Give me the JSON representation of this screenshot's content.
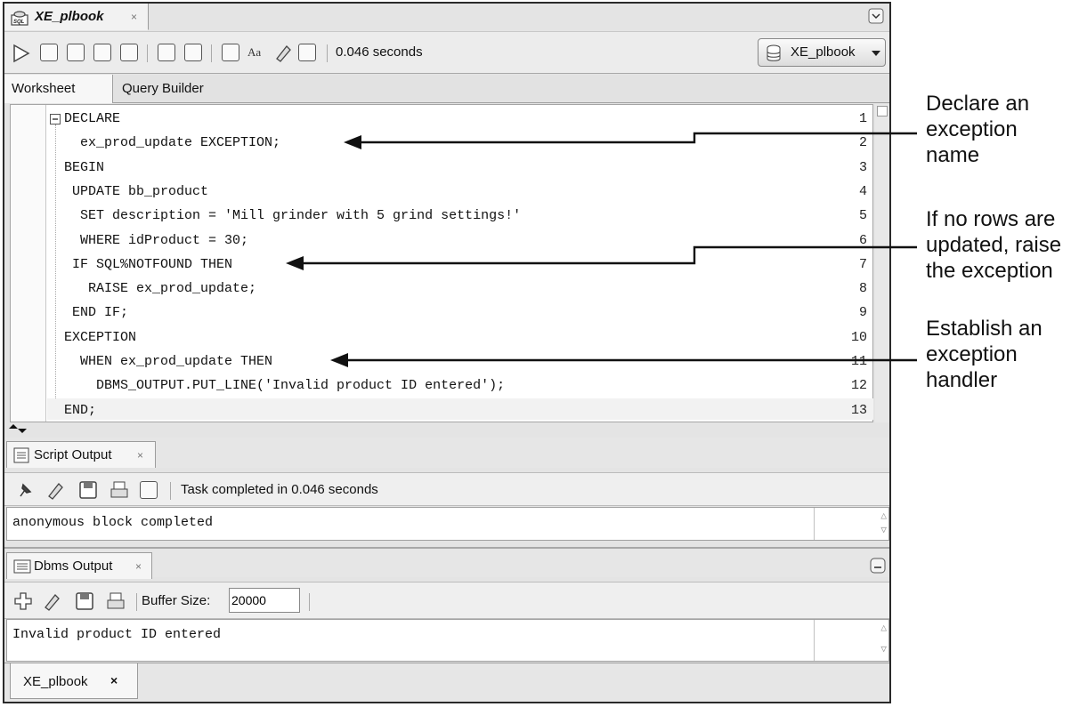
{
  "document_tab": {
    "label": "XE_plbook",
    "close": "×"
  },
  "toolbar": {
    "status_text": "0.046 seconds",
    "connection": "XE_plbook"
  },
  "subtabs": [
    "Worksheet",
    "Query Builder"
  ],
  "editor": {
    "lines": [
      {
        "num": "1",
        "text": "DECLARE"
      },
      {
        "num": "2",
        "text": "  ex_prod_update EXCEPTION;"
      },
      {
        "num": "3",
        "text": "BEGIN"
      },
      {
        "num": "4",
        "text": " UPDATE bb_product"
      },
      {
        "num": "5",
        "text": "  SET description = 'Mill grinder with 5 grind settings!'"
      },
      {
        "num": "6",
        "text": "  WHERE idProduct = 30;"
      },
      {
        "num": "7",
        "text": " IF SQL%NOTFOUND THEN"
      },
      {
        "num": "8",
        "text": "   RAISE ex_prod_update;"
      },
      {
        "num": "9",
        "text": " END IF;"
      },
      {
        "num": "10",
        "text": "EXCEPTION"
      },
      {
        "num": "11",
        "text": "  WHEN ex_prod_update THEN"
      },
      {
        "num": "12",
        "text": "    DBMS_OUTPUT.PUT_LINE('Invalid product ID entered');"
      },
      {
        "num": "13",
        "text": "END;"
      }
    ]
  },
  "script_output": {
    "tab_label": "Script Output",
    "close": "×",
    "status": "Task completed in 0.046 seconds",
    "text": "anonymous block completed"
  },
  "dbms_output": {
    "tab_label": "Dbms Output",
    "close": "×",
    "buffer_label": "Buffer Size:",
    "buffer_value": "20000",
    "text": "Invalid product ID entered"
  },
  "bottom_tab": {
    "label": "XE_plbook",
    "close": "×"
  },
  "annotations": [
    {
      "lines": [
        "Declare an",
        "exception",
        "name"
      ]
    },
    {
      "lines": [
        "If no rows are",
        "updated, raise",
        "the exception"
      ]
    },
    {
      "lines": [
        "Establish an",
        "exception",
        "handler"
      ]
    }
  ]
}
